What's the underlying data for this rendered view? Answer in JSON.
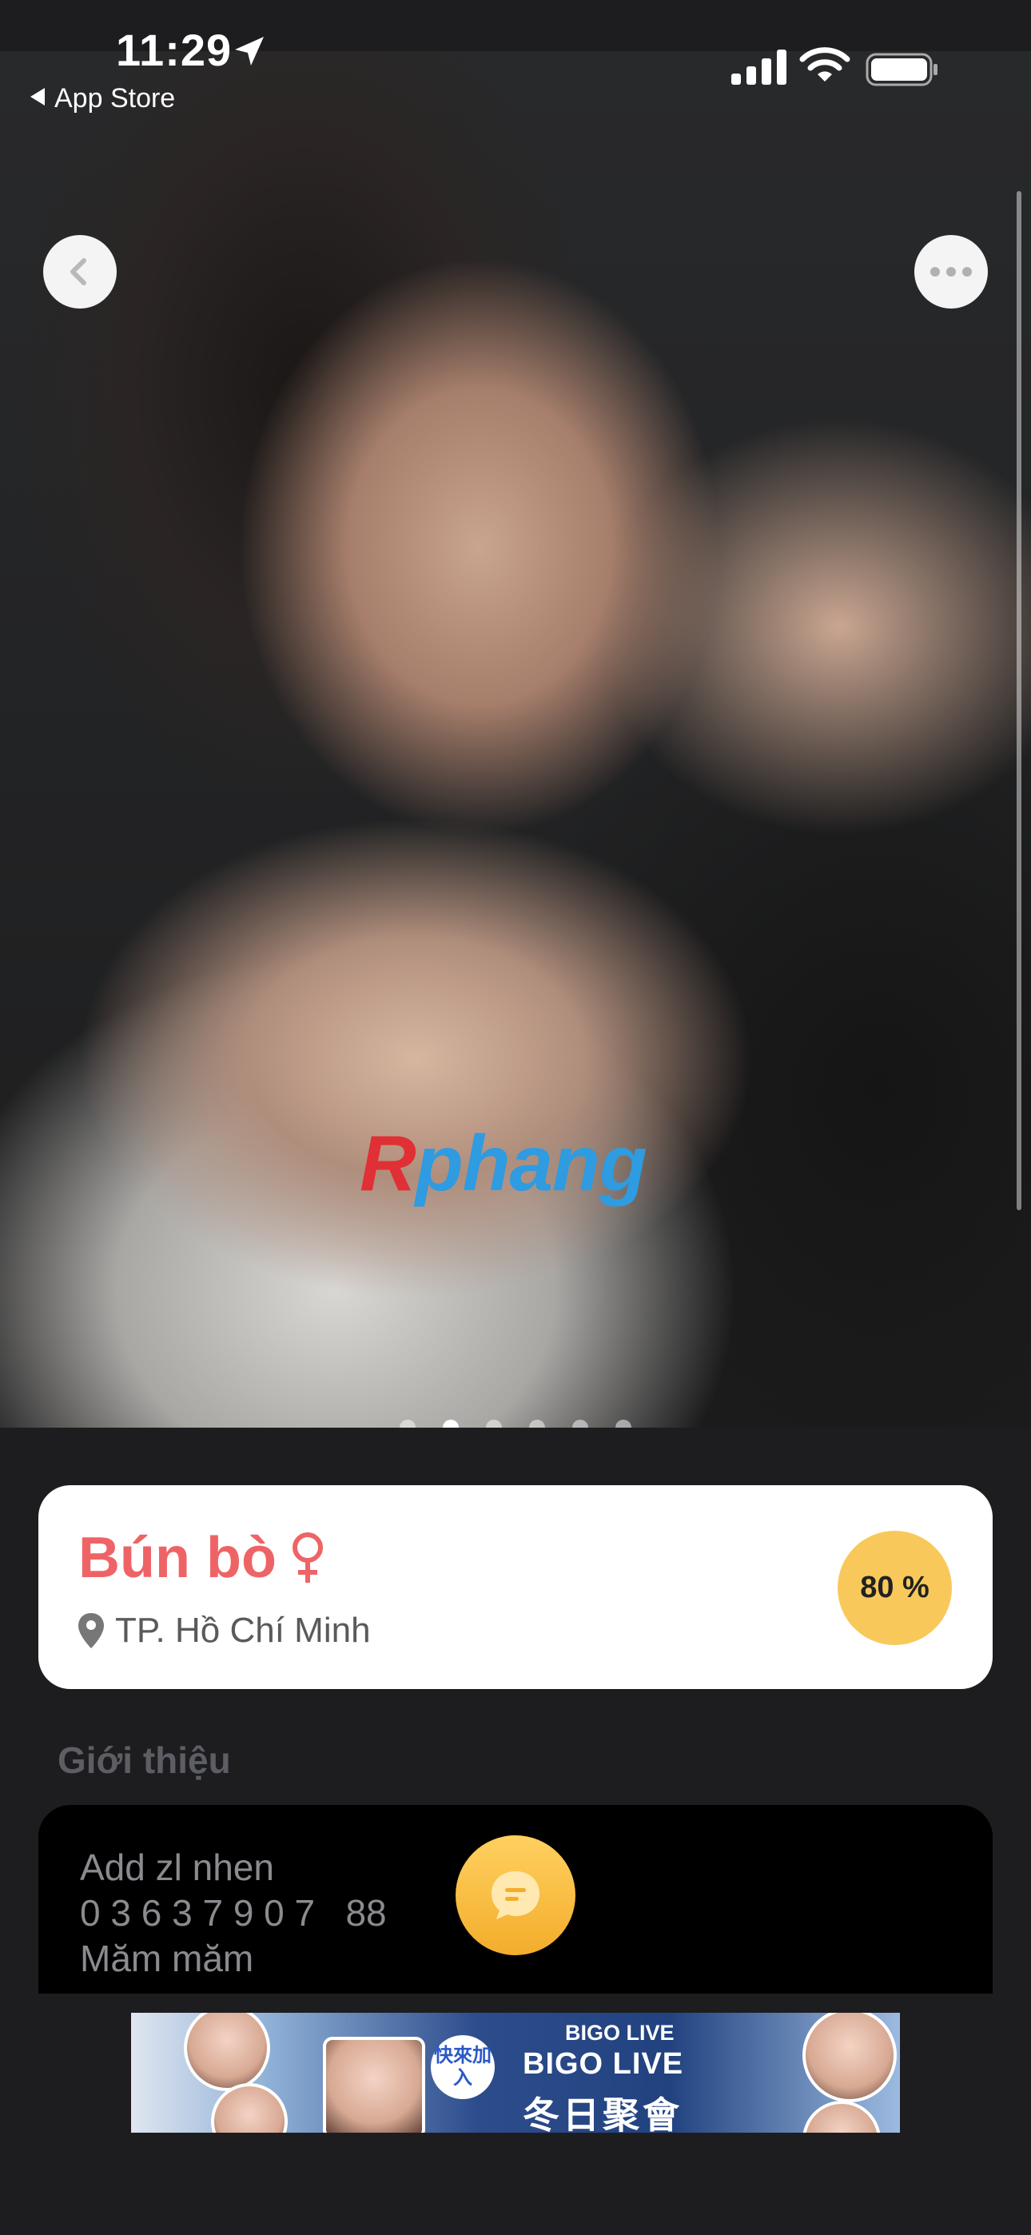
{
  "status_bar": {
    "time": "11:29",
    "back_to_app": "App Store"
  },
  "photo": {
    "watermark_first": "R",
    "watermark_rest": "phang",
    "page_count": 6,
    "active_page": 2
  },
  "profile": {
    "name": "Bún bò",
    "gender": "female-icon",
    "location": "TP. Hồ Chí Minh",
    "match_percent": "80 %"
  },
  "intro": {
    "section_title": "Giới thiệu",
    "text": "Add zl nhen\n0 3 6 3 7 9 0 7   88\nMăm măm"
  },
  "ad": {
    "brand": "BIGO LIVE",
    "title": "BIGO LIVE",
    "subtitle": "冬日聚會",
    "join": "快來加入"
  },
  "colors": {
    "accent_name": "#ee6466",
    "match_badge": "#f8c95a",
    "chat_button": "#f3ad2b",
    "background": "#1d1d20"
  }
}
